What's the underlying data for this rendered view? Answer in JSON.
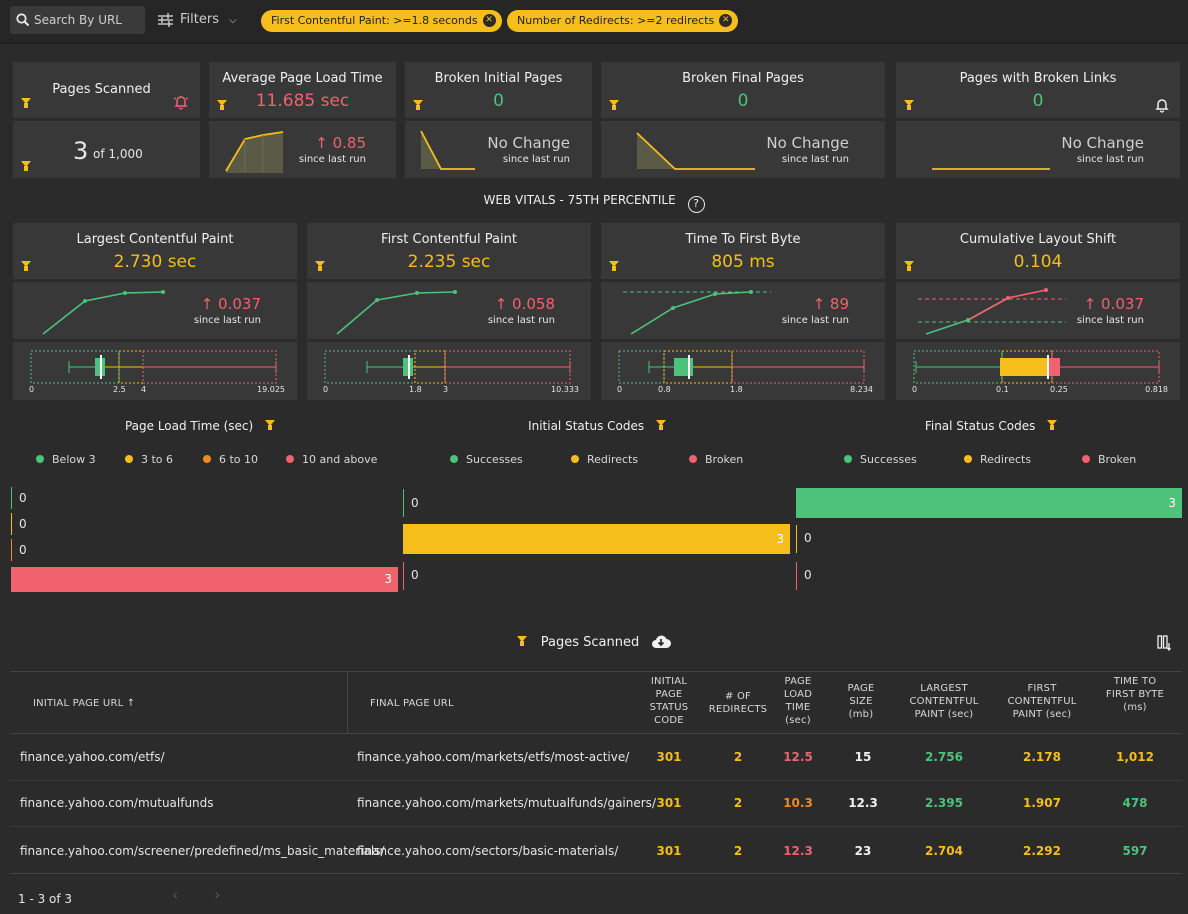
{
  "toolbar": {
    "search_placeholder": "Search By URL",
    "filters_label": "Filters",
    "chips": [
      "First Contentful Paint: >=1.8 seconds",
      "Number of Redirects: >=2 redirects"
    ]
  },
  "summary_cards": {
    "pages_scanned": {
      "title": "Pages Scanned",
      "count": "3",
      "of": "of 1,000"
    },
    "avg_load": {
      "title": "Average Page Load Time",
      "value": "11.685 sec",
      "change": "↑ 0.85",
      "since": "since last run"
    },
    "broken_initial": {
      "title": "Broken Initial Pages",
      "value": "0",
      "change": "No Change",
      "since": "since last run"
    },
    "broken_final": {
      "title": "Broken Final Pages",
      "value": "0",
      "change": "No Change",
      "since": "since last run"
    },
    "broken_links": {
      "title": "Pages with Broken Links",
      "value": "0",
      "change": "No Change",
      "since": "since last run"
    }
  },
  "web_vitals": {
    "heading": "WEB VITALS - 75TH PERCENTILE",
    "cards": [
      {
        "title": "Largest Contentful Paint",
        "value": "2.730 sec",
        "change": "↑ 0.037",
        "since": "since last run",
        "axis": [
          "0",
          "2.5",
          "4",
          "19.025"
        ]
      },
      {
        "title": "First Contentful Paint",
        "value": "2.235 sec",
        "change": "↑ 0.058",
        "since": "since last run",
        "axis": [
          "0",
          "1.8",
          "3",
          "10.333"
        ]
      },
      {
        "title": "Time To First Byte",
        "value": "805 ms",
        "change": "↑ 89",
        "since": "since last run",
        "axis": [
          "0",
          "0.8",
          "1.8",
          "8.234"
        ]
      },
      {
        "title": "Cumulative Layout Shift",
        "value": "0.104",
        "change": "↑ 0.037",
        "since": "since last run",
        "axis": [
          "0",
          "0.1",
          "0.25",
          "0.818"
        ]
      }
    ]
  },
  "distribution": {
    "load_time": {
      "title": "Page Load Time (sec)",
      "legend": [
        "Below 3",
        "3 to 6",
        "6 to 10",
        "10 and above"
      ],
      "values": [
        "0",
        "0",
        "0",
        "3"
      ]
    },
    "initial_status": {
      "title": "Initial Status Codes",
      "legend": [
        "Successes",
        "Redirects",
        "Broken"
      ],
      "values": [
        "0",
        "3",
        "0"
      ]
    },
    "final_status": {
      "title": "Final Status Codes",
      "legend": [
        "Successes",
        "Redirects",
        "Broken"
      ],
      "values": [
        "3",
        "0",
        "0"
      ]
    }
  },
  "colors": {
    "green": "#4cc27a",
    "yellow": "#f5be1b",
    "orange": "#f08a24",
    "red": "#f0626d"
  },
  "pages_table": {
    "title": "Pages Scanned",
    "headers": {
      "initial_url": "INITIAL PAGE URL ↑",
      "final_url": "FINAL PAGE URL",
      "initial_status": "INITIAL PAGE STATUS CODE",
      "redirects": "# OF REDIRECTS",
      "load_time": "PAGE LOAD TIME (sec)",
      "page_size": "PAGE SIZE (mb)",
      "lcp": "LARGEST CONTENTFUL PAINT (sec)",
      "fcp": "FIRST CONTENTFUL PAINT (sec)",
      "ttfb": "TIME TO FIRST BYTE (ms)"
    },
    "rows": [
      {
        "initial": "finance.yahoo.com/etfs/",
        "final": "finance.yahoo.com/markets/etfs/most-active/",
        "status": "301",
        "redirects": "2",
        "load": "12.5",
        "size": "15",
        "lcp": "2.756",
        "fcp": "2.178",
        "ttfb": "1,012"
      },
      {
        "initial": "finance.yahoo.com/mutualfunds",
        "final": "finance.yahoo.com/markets/mutualfunds/gainers/",
        "status": "301",
        "redirects": "2",
        "load": "10.3",
        "size": "12.3",
        "lcp": "2.395",
        "fcp": "1.907",
        "ttfb": "478"
      },
      {
        "initial": "finance.yahoo.com/screener/predefined/ms_basic_materials/",
        "final": "finance.yahoo.com/sectors/basic-materials/",
        "status": "301",
        "redirects": "2",
        "load": "12.3",
        "size": "23",
        "lcp": "2.704",
        "fcp": "2.292",
        "ttfb": "597"
      }
    ],
    "pagination": "1 - 3 of 3"
  }
}
